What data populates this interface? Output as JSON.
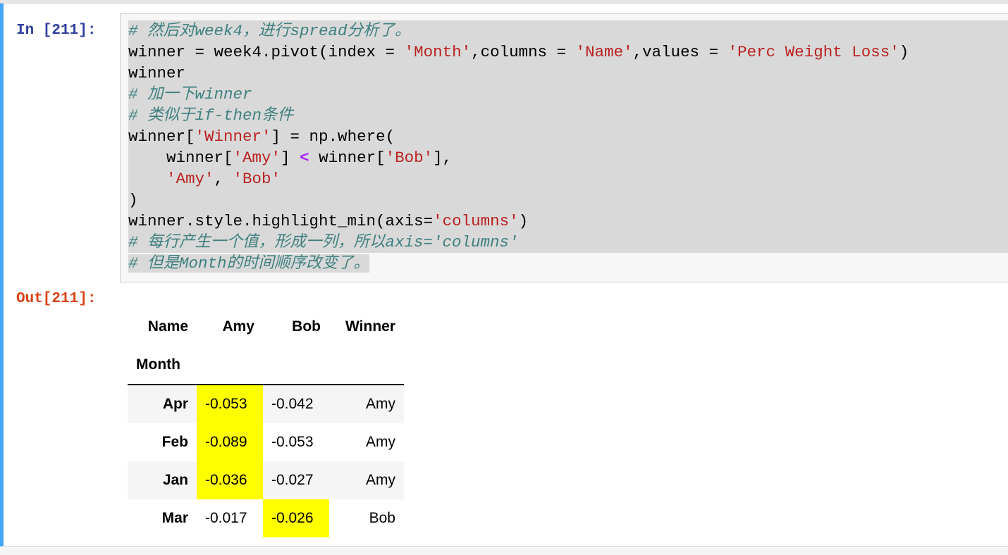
{
  "notebook": {
    "cell": {
      "input_prompt": "In [211]:",
      "output_prompt": "Out[211]:",
      "code_lines": [
        [
          {
            "t": "# 然后对week4，进行spread分析了。",
            "c": "comment"
          }
        ],
        [
          {
            "t": "winner = week4.pivot(index = ",
            "c": "plain"
          },
          {
            "t": "'Month'",
            "c": "str"
          },
          {
            "t": ",columns = ",
            "c": "plain"
          },
          {
            "t": "'Name'",
            "c": "str"
          },
          {
            "t": ",values = ",
            "c": "plain"
          },
          {
            "t": "'Perc Weight Loss'",
            "c": "str"
          },
          {
            "t": ")",
            "c": "plain"
          }
        ],
        [
          {
            "t": "winner",
            "c": "plain"
          }
        ],
        [
          {
            "t": "# 加一下winner",
            "c": "comment"
          }
        ],
        [
          {
            "t": "# 类似于if-then条件",
            "c": "comment"
          }
        ],
        [
          {
            "t": "winner[",
            "c": "plain"
          },
          {
            "t": "'Winner'",
            "c": "str"
          },
          {
            "t": "] = np.where(",
            "c": "plain"
          }
        ],
        [
          {
            "t": "    winner[",
            "c": "plain"
          },
          {
            "t": "'Amy'",
            "c": "str"
          },
          {
            "t": "] ",
            "c": "plain"
          },
          {
            "t": "<",
            "c": "op"
          },
          {
            "t": " winner[",
            "c": "plain"
          },
          {
            "t": "'Bob'",
            "c": "str"
          },
          {
            "t": "],",
            "c": "plain"
          }
        ],
        [
          {
            "t": "    ",
            "c": "plain"
          },
          {
            "t": "'Amy'",
            "c": "str"
          },
          {
            "t": ", ",
            "c": "plain"
          },
          {
            "t": "'Bob'",
            "c": "str"
          }
        ],
        [
          {
            "t": ")",
            "c": "plain"
          }
        ],
        [
          {
            "t": "winner.style.highlight_min(axis=",
            "c": "plain"
          },
          {
            "t": "'columns'",
            "c": "str"
          },
          {
            "t": ")",
            "c": "plain"
          }
        ],
        [
          {
            "t": "# 每行产生一个值，形成一列，所以axis='columns'",
            "c": "comment"
          }
        ],
        [
          {
            "t": "# 但是Month的时间顺序改变了。",
            "c": "comment"
          }
        ]
      ]
    },
    "output_table": {
      "columns_name": "Name",
      "columns": [
        "Amy",
        "Bob",
        "Winner"
      ],
      "index_name": "Month",
      "highlight_color": "#ffff00",
      "rows": [
        {
          "index": "Apr",
          "values": [
            "-0.053",
            "-0.042",
            "Amy"
          ],
          "highlight": [
            true,
            false,
            false
          ]
        },
        {
          "index": "Feb",
          "values": [
            "-0.089",
            "-0.053",
            "Amy"
          ],
          "highlight": [
            true,
            false,
            false
          ]
        },
        {
          "index": "Jan",
          "values": [
            "-0.036",
            "-0.027",
            "Amy"
          ],
          "highlight": [
            true,
            false,
            false
          ]
        },
        {
          "index": "Mar",
          "values": [
            "-0.017",
            "-0.026",
            "Bob"
          ],
          "highlight": [
            false,
            true,
            false
          ]
        }
      ]
    }
  },
  "colors": {
    "selected_cell_border": "#42a5f5",
    "input_prompt": "#303f9f",
    "output_prompt": "#d84315",
    "string": "#ba2121",
    "comment": "#408080",
    "operator": "#aa22ff",
    "selection": "#d9d9d9"
  }
}
